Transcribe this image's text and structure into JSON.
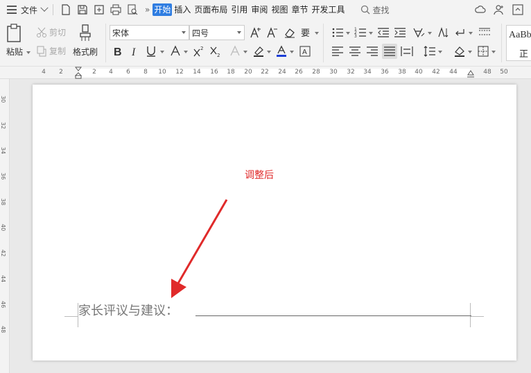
{
  "menubar": {
    "file_label": "文件",
    "more_label": "»",
    "tabs": [
      {
        "label": "开始",
        "active": true
      },
      {
        "label": "插入",
        "active": false
      },
      {
        "label": "页面布局",
        "active": false
      },
      {
        "label": "引用",
        "active": false
      },
      {
        "label": "审阅",
        "active": false
      },
      {
        "label": "视图",
        "active": false
      },
      {
        "label": "章节",
        "active": false
      },
      {
        "label": "开发工具",
        "active": false
      }
    ],
    "search_label": "查找",
    "accent_color": "#2f7de1"
  },
  "ribbon": {
    "paste_label": "粘贴",
    "cut_label": "剪切",
    "copy_label": "复制",
    "format_painter_label": "格式刷",
    "font_name": "宋体",
    "font_size": "四号",
    "style_preview": "AaBbC",
    "style_preview_2": "正"
  },
  "ruler": {
    "h_ticks": [
      "4",
      "2",
      "2",
      "4",
      "6",
      "8",
      "10",
      "12",
      "14",
      "16",
      "18",
      "20",
      "22",
      "24",
      "26",
      "28",
      "30",
      "32",
      "34",
      "36",
      "38",
      "40",
      "42",
      "44",
      "48",
      "50"
    ],
    "v_ticks": [
      "30",
      "32",
      "34",
      "36",
      "38",
      "40",
      "42",
      "44",
      "46",
      "48"
    ]
  },
  "document": {
    "annotation": "调整后",
    "annotation_color": "#e02a2a",
    "comment_label": "家长评议与建议："
  }
}
